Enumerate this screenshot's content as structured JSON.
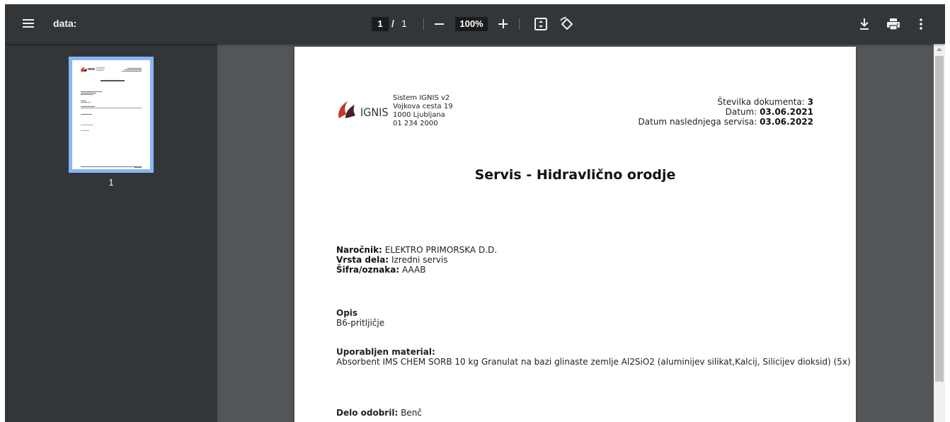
{
  "toolbar": {
    "title": "data:",
    "page_current": "1",
    "page_separator": "/",
    "page_total": "1",
    "zoom": "100%"
  },
  "sidebar": {
    "thumbnail_label": "1"
  },
  "document": {
    "logo_text": "IGNIS",
    "company": {
      "name": "Sistem IGNIS v2",
      "street": "Vojkova cesta 19",
      "city": "1000 Ljubljana",
      "phone": "01 234 2000"
    },
    "meta": {
      "doc_number_label": "Številka dokumenta:",
      "doc_number_value": "3",
      "date_label": "Datum:",
      "date_value": "03.06.2021",
      "next_service_label": "Datum naslednjega servisa:",
      "next_service_value": "03.06.2022"
    },
    "title": "Servis - Hidravlično orodje",
    "client_label": "Naročnik:",
    "client_value": "ELEKTRO PRIMORSKA D.D.",
    "work_type_label": "Vrsta dela:",
    "work_type_value": "Izredni servis",
    "code_label": "Šifra/oznaka:",
    "code_value": "AAAB",
    "description_label": "Opis",
    "description_value": "B6-pritljičje",
    "material_label": "Uporabljen material:",
    "material_value": "Absorbent IMS CHEM SORB 10 kg Granulat na bazi glinaste zemlje Al2SiO2 (aluminijev silikat,Kalcij, Silicijev dioksid) (5x)",
    "approved_label": "Delo odobril:",
    "approved_value": "Benč"
  },
  "colors": {
    "toolbar_bg": "#323639",
    "viewer_bg": "#525659",
    "thumb_highlight": "#8ab4f8",
    "logo_red": "#c0392b",
    "logo_dark": "#4a1f2a"
  },
  "icons": [
    "menu-icon",
    "zoom-out-icon",
    "zoom-in-icon",
    "fit-page-icon",
    "rotate-icon",
    "download-icon",
    "print-icon",
    "more-vert-icon"
  ]
}
